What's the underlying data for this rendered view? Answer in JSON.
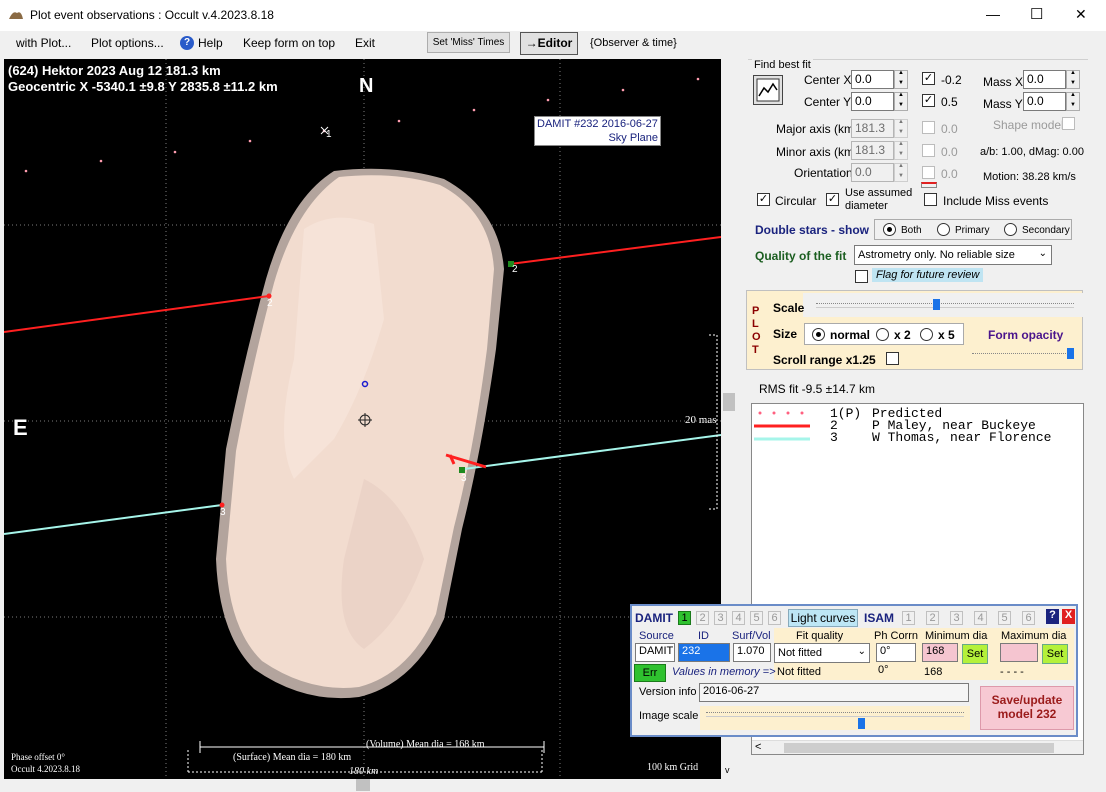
{
  "window": {
    "title": "Plot event observations : Occult v.4.2023.8.18",
    "min": "—",
    "max": "☐",
    "close": "✕"
  },
  "menu": {
    "with_plot": "with Plot...",
    "plot_options": "Plot options...",
    "help": "Help",
    "keep_on_top": "Keep form on top",
    "exit": "Exit",
    "set_miss": "Set 'Miss' Times",
    "editor": "→Editor",
    "observer_time": "{Observer & time}"
  },
  "plot": {
    "header1": "(624) Hektor  2023 Aug 12   181.3 km",
    "header2": "Geocentric  X  -5340.1 ±9.8  Y 2835.8 ±11.2 km",
    "north": "N",
    "east": "E",
    "damit_label1": "DAMIT #232 2016-06-27",
    "damit_label2": "Sky Plane",
    "scale_label": "20 mas",
    "chord_1": "1",
    "chord_2a": "2",
    "chord_2b": "2",
    "chord_3a": "3",
    "chord_3b": "3",
    "phase_offset": "Phase offset 0°",
    "occult_version": "Occult 4.2023.8.18",
    "volume_dia": "(Volume) Mean dia = 168 km",
    "surface_dia": "(Surface) Mean dia = 180 km",
    "dia_180": "180 km",
    "grid": "100 km Grid",
    "colors": {
      "shape": "#f3dcd0",
      "chord2": "#ff2020",
      "chord3": "#a6f5ea",
      "grid": "#8a8a8a"
    }
  },
  "fit": {
    "find_best_fit": "Find best fit",
    "center_x_label": "Center X",
    "center_x": "0.0",
    "center_y_label": "Center Y",
    "center_y": "0.0",
    "major_label": "Major axis (km)",
    "major": "181.3",
    "minor_label": "Minor axis (km)",
    "minor": "181.3",
    "orient_label": "Orientation",
    "orient": "0.0",
    "cb1_val": "-0.2",
    "cb2_val": "0.5",
    "cb3_val": "0.0",
    "cb4_val": "0.0",
    "cb5_val": "0.0",
    "mass_x_label": "Mass X",
    "mass_x": "0.0",
    "mass_y_label": "Mass Y",
    "mass_y": "0.0",
    "shape_model": "Shape model",
    "ab": "a/b: 1.00, dMag: 0.00",
    "motion": "Motion: 38.28 km/s",
    "circular": "Circular",
    "use_assumed": "Use assumed",
    "diameter": "diameter",
    "include_miss": "Include Miss events",
    "double_stars": "Double stars - show",
    "both": "Both",
    "primary": "Primary",
    "secondary": "Secondary",
    "quality_label": "Quality of the fit",
    "quality_value": "Astrometry only. No reliable size",
    "flag_review": "Flag for future review"
  },
  "plotbox": {
    "plot_letters": [
      "P",
      "L",
      "O",
      "T"
    ],
    "scale": "Scale",
    "size": "Size",
    "normal": "normal",
    "x2": "x 2",
    "x5": "x 5",
    "form_opacity": "Form opacity",
    "scroll_range": "Scroll range x1.25"
  },
  "rms": "RMS fit -9.5 ±14.7 km",
  "legend": [
    {
      "num": "1(P)",
      "name": "Predicted"
    },
    {
      "num": "2",
      "name": "P Maley, near Buckeye"
    },
    {
      "num": "3",
      "name": "W Thomas, near Florence"
    }
  ],
  "damit": {
    "damit_label": "DAMIT",
    "nums": [
      "1",
      "2",
      "3",
      "4",
      "5",
      "6"
    ],
    "light_curves": "Light curves",
    "isam_label": "ISAM",
    "isam_nums": [
      "1",
      "2",
      "3",
      "4",
      "5",
      "6"
    ],
    "help": "?",
    "close": "X",
    "source_label": "Source",
    "id_label": "ID",
    "surfvol_label": "Surf/Vol",
    "fitq_label": "Fit quality",
    "phcorr_label": "Ph Corrn",
    "mindia_label": "Minimum dia",
    "maxdia_label": "Maximum dia",
    "source": "DAMIT",
    "id": "232",
    "surfvol": "1.070",
    "fitq": "Not fitted",
    "phcorr": "0°",
    "mindia": "168",
    "set1": "Set",
    "set2": "Set",
    "err": "Err",
    "values_mem": "Values in memory =>",
    "mem_fitq": "Not fitted",
    "mem_ph": "0°",
    "mem_min": "168",
    "mem_max": "- - - -",
    "version_label": "Version info",
    "version": "2016-06-27",
    "image_scale": "Image scale",
    "save_line1": "Save/update",
    "save_line2": "model 232"
  }
}
